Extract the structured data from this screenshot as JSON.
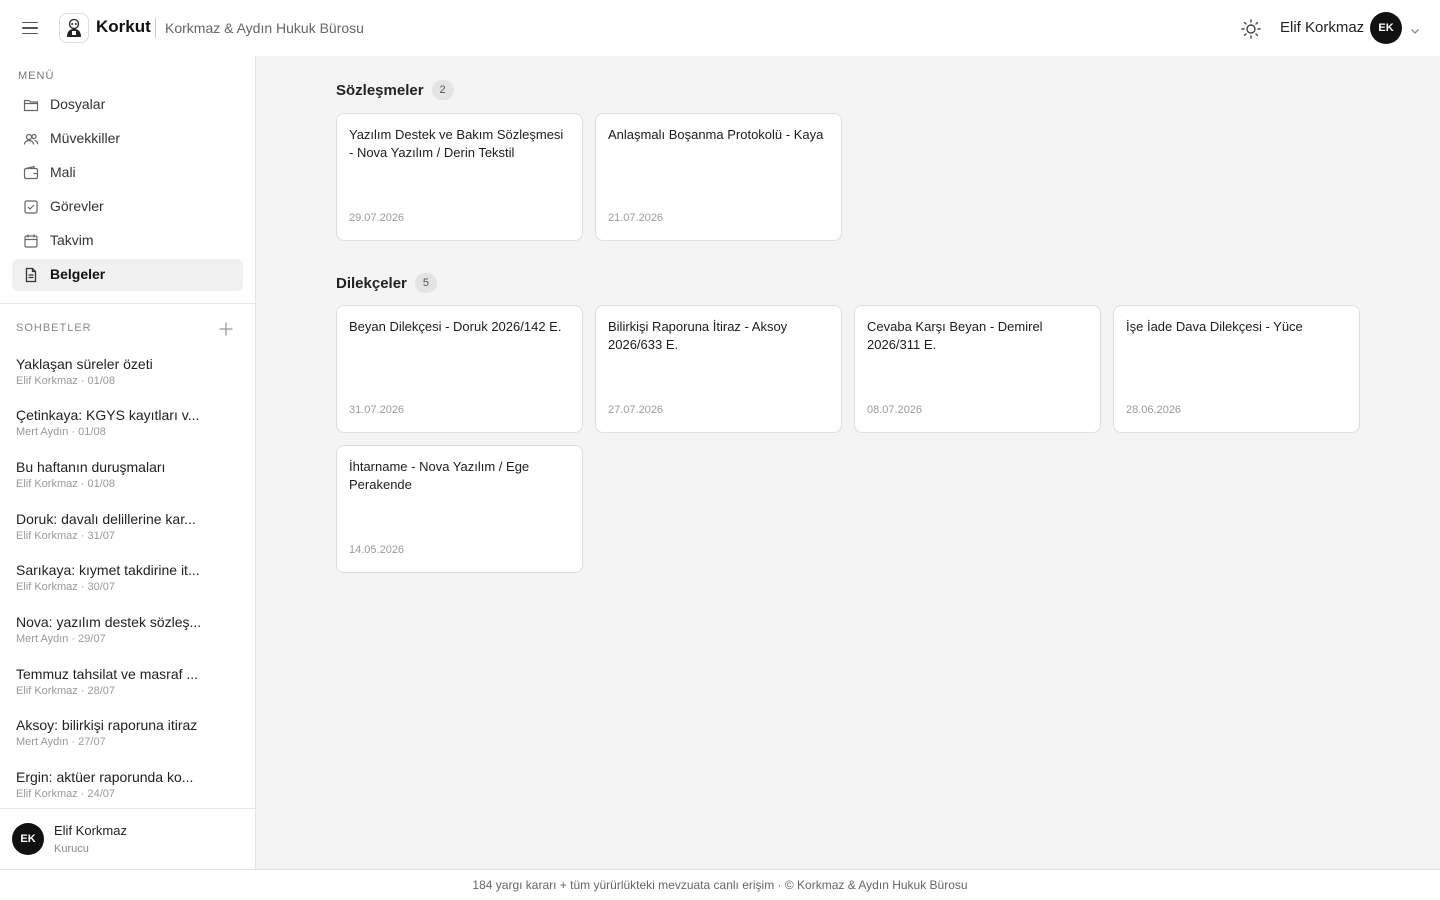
{
  "header": {
    "brand": "Korkut",
    "firm": "Korkmaz & Aydın Hukuk Bürosu",
    "user_name": "Elif Korkmaz",
    "user_initials": "EK"
  },
  "sidebar": {
    "menu_label": "MENÜ",
    "items": [
      {
        "label": "Dosyalar",
        "icon": "folder-icon"
      },
      {
        "label": "Müvekkiller",
        "icon": "users-icon"
      },
      {
        "label": "Mali",
        "icon": "wallet-icon"
      },
      {
        "label": "Görevler",
        "icon": "checkbox-icon"
      },
      {
        "label": "Takvim",
        "icon": "calendar-icon"
      },
      {
        "label": "Belgeler",
        "icon": "document-icon",
        "active": true
      }
    ],
    "chats_label": "SOHBETLER",
    "chats": [
      {
        "title": "Yaklaşan süreler özeti",
        "meta": "Elif Korkmaz · 01/08"
      },
      {
        "title": "Çetinkaya: KGYS kayıtları v...",
        "meta": "Mert Aydın · 01/08"
      },
      {
        "title": "Bu haftanın duruşmaları",
        "meta": "Elif Korkmaz · 01/08"
      },
      {
        "title": "Doruk: davalı delillerine kar...",
        "meta": "Elif Korkmaz · 31/07"
      },
      {
        "title": "Sarıkaya: kıymet takdirine it...",
        "meta": "Elif Korkmaz · 30/07"
      },
      {
        "title": "Nova: yazılım destek sözleş...",
        "meta": "Mert Aydın · 29/07"
      },
      {
        "title": "Temmuz tahsilat ve masraf ...",
        "meta": "Elif Korkmaz · 28/07"
      },
      {
        "title": "Aksoy: bilirkişi raporuna itiraz",
        "meta": "Mert Aydın · 27/07"
      },
      {
        "title": "Ergin: aktüer raporunda ko...",
        "meta": "Elif Korkmaz · 24/07"
      }
    ],
    "footer": {
      "name": "Elif Korkmaz",
      "role": "Kurucu",
      "initials": "EK"
    }
  },
  "main": {
    "sections": [
      {
        "title": "Sözleşmeler",
        "count": "2",
        "docs": [
          {
            "title": "Yazılım Destek ve Bakım Sözleşmesi - Nova Yazılım / Derin Tekstil",
            "date": "29.07.2026"
          },
          {
            "title": "Anlaşmalı Boşanma Protokolü - Kaya",
            "date": "21.07.2026"
          }
        ]
      },
      {
        "title": "Dilekçeler",
        "count": "5",
        "docs": [
          {
            "title": "Beyan Dilekçesi - Doruk 2026/142 E.",
            "date": "31.07.2026"
          },
          {
            "title": "Bilirkişi Raporuna İtiraz - Aksoy 2026/633 E.",
            "date": "27.07.2026"
          },
          {
            "title": "Cevaba Karşı Beyan - Demirel 2026/311 E.",
            "date": "08.07.2026"
          },
          {
            "title": "İşe İade Dava Dilekçesi - Yüce",
            "date": "28.06.2026"
          },
          {
            "title": "İhtarname - Nova Yazılım / Ege Perakende",
            "date": "14.05.2026"
          }
        ]
      }
    ]
  },
  "footer": {
    "text": "184 yargı kararı + tüm yürürlükteki mevzuata canlı erişim · © Korkmaz & Aydın Hukuk Bürosu"
  }
}
